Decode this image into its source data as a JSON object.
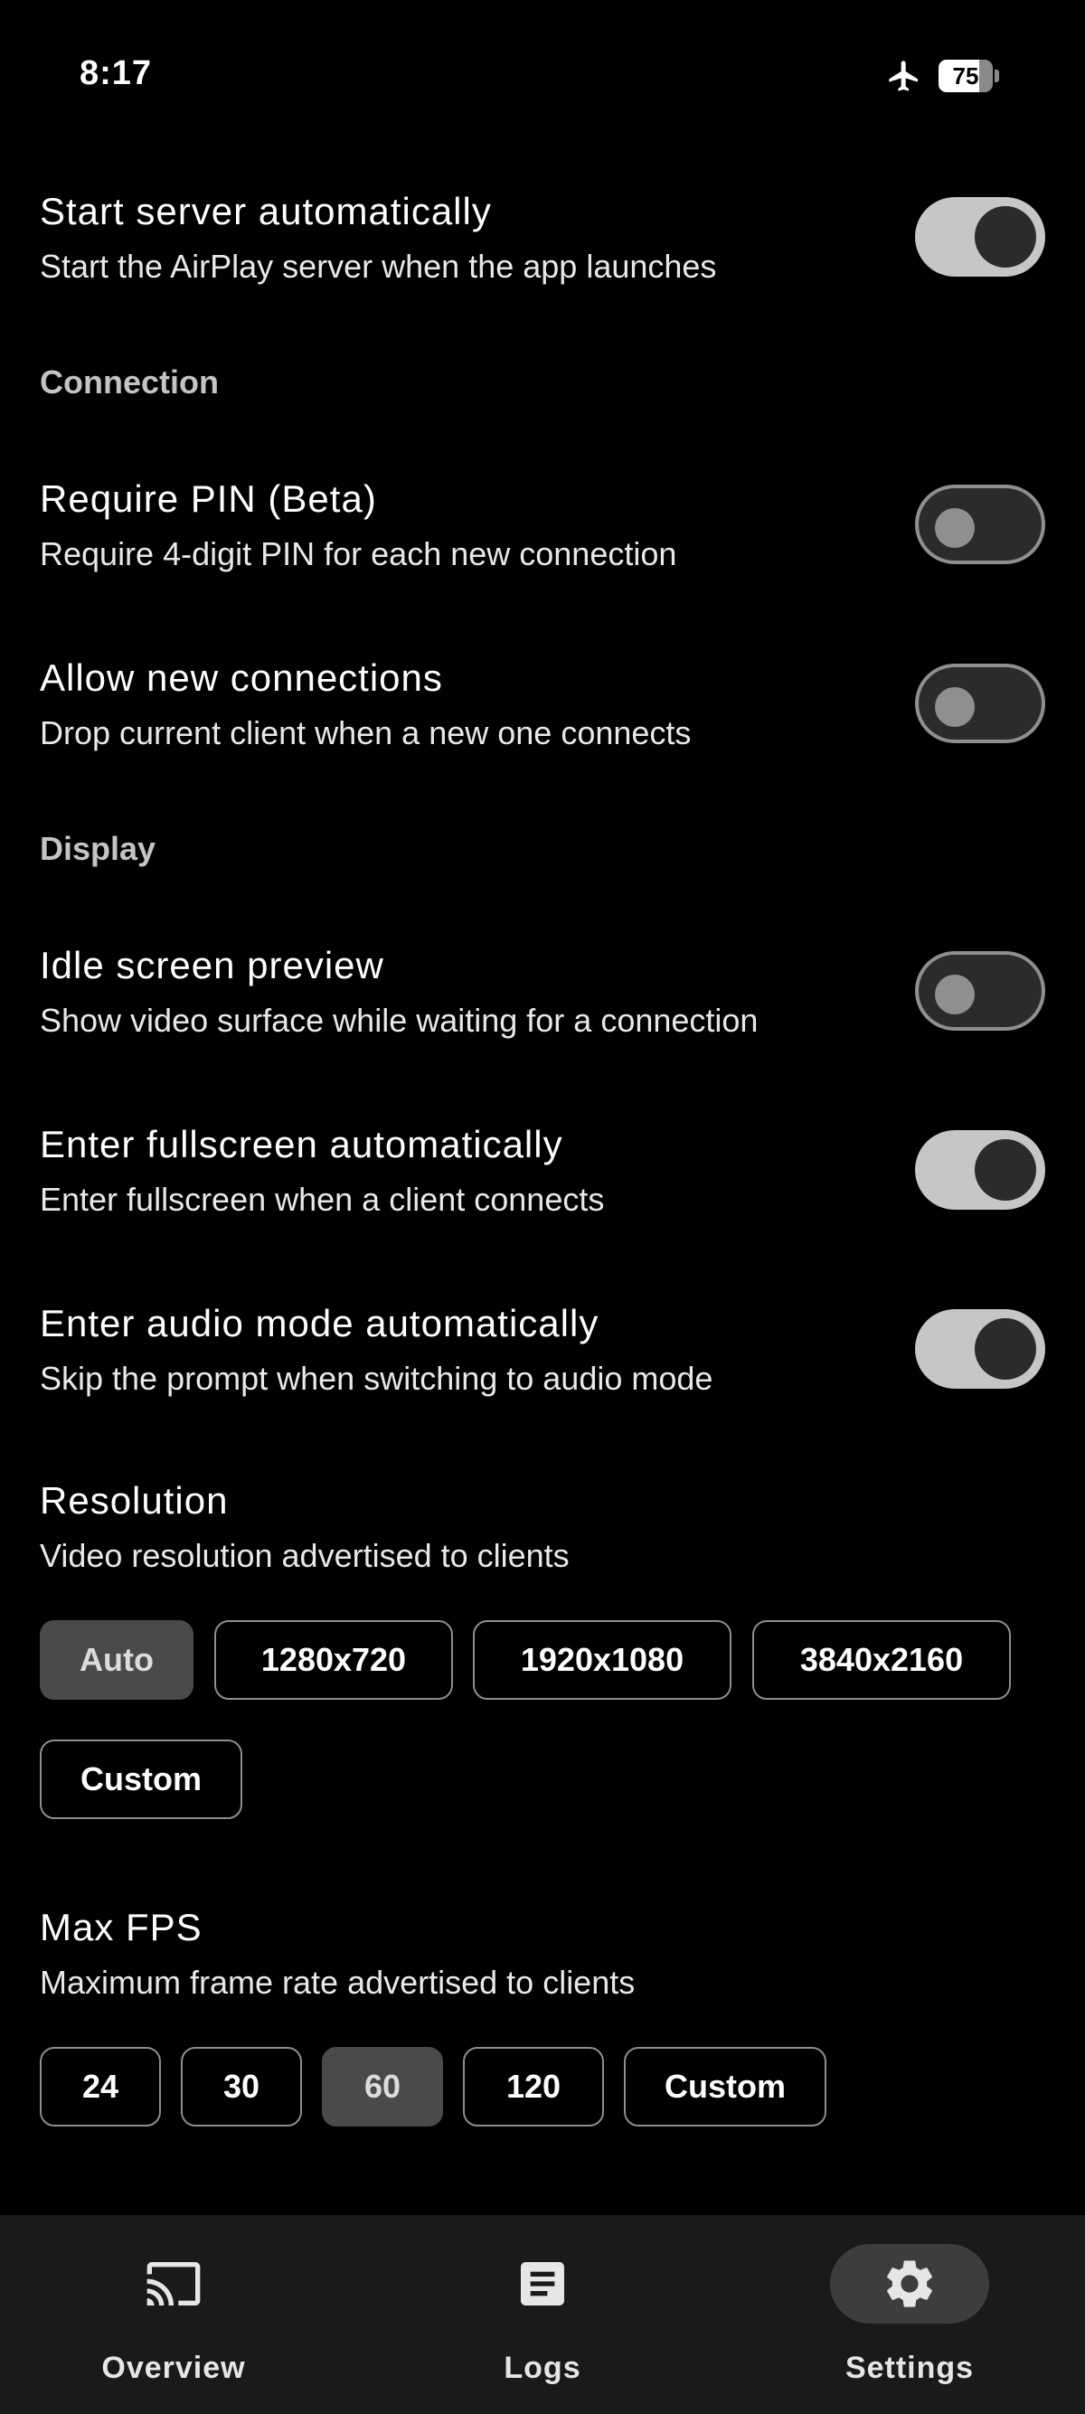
{
  "status_bar": {
    "time": "8:17",
    "battery_level": "75",
    "airplane_icon": "airplane-icon"
  },
  "settings": {
    "start_server": {
      "title": "Start server automatically",
      "subtitle": "Start the AirPlay server when the app launches",
      "enabled": true
    },
    "connection_header": "Connection",
    "require_pin": {
      "title": "Require PIN (Beta)",
      "subtitle": "Require 4-digit PIN for each new connection",
      "enabled": false
    },
    "allow_new_connections": {
      "title": "Allow new connections",
      "subtitle": "Drop current client when a new one connects",
      "enabled": false
    },
    "display_header": "Display",
    "idle_preview": {
      "title": "Idle screen preview",
      "subtitle": "Show video surface while waiting for a connection",
      "enabled": false
    },
    "auto_fullscreen": {
      "title": "Enter fullscreen automatically",
      "subtitle": "Enter fullscreen when a client connects",
      "enabled": true
    },
    "auto_audio_mode": {
      "title": "Enter audio mode automatically",
      "subtitle": "Skip the prompt when switching to audio mode",
      "enabled": true
    },
    "resolution": {
      "title": "Resolution",
      "subtitle": "Video resolution advertised to clients",
      "options": [
        "Auto",
        "1280x720",
        "1920x1080",
        "3840x2160",
        "Custom"
      ],
      "selected": "Auto"
    },
    "max_fps": {
      "title": "Max FPS",
      "subtitle": "Maximum frame rate advertised to clients",
      "options": [
        "24",
        "30",
        "60",
        "120",
        "Custom"
      ],
      "selected": "60"
    }
  },
  "bottom_nav": {
    "items": [
      {
        "label": "Overview",
        "icon": "cast-icon",
        "active": false
      },
      {
        "label": "Logs",
        "icon": "document-icon",
        "active": false
      },
      {
        "label": "Settings",
        "icon": "gear-icon",
        "active": true
      }
    ]
  },
  "colors": {
    "background": "#000000",
    "toggle_on_track": "#c6c6c6",
    "toggle_off_border": "#8f8f8f",
    "chip_selected": "#4a4a4a",
    "nav_background": "#1a1a1a"
  }
}
